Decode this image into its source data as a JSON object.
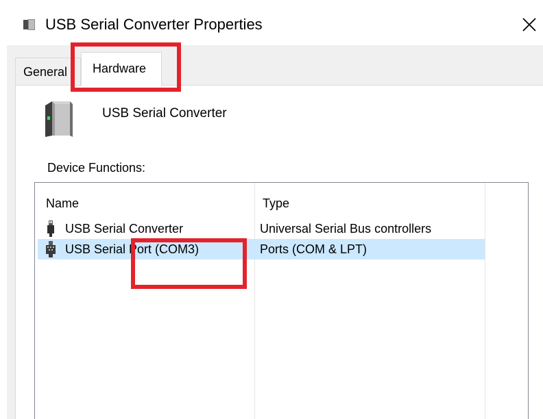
{
  "window": {
    "title": "USB Serial Converter Properties",
    "close_icon": "close-icon"
  },
  "tabs": [
    {
      "label": "General",
      "active": false
    },
    {
      "label": "Hardware",
      "active": true
    }
  ],
  "device": {
    "name": "USB Serial Converter",
    "icon": "usb-device-icon"
  },
  "device_functions": {
    "label": "Device Functions:",
    "columns": [
      "Name",
      "Type"
    ],
    "rows": [
      {
        "name": "USB Serial Converter",
        "type": "Universal Serial Bus controllers",
        "icon": "usb-plug-icon",
        "selected": false
      },
      {
        "name": "USB Serial Port (COM3)",
        "type": "Ports (COM & LPT)",
        "icon": "port-icon",
        "selected": true
      }
    ]
  },
  "colors": {
    "annotation": "#e3232c",
    "selection": "#cce8ff",
    "dialog_background": "#f0f0f0"
  }
}
